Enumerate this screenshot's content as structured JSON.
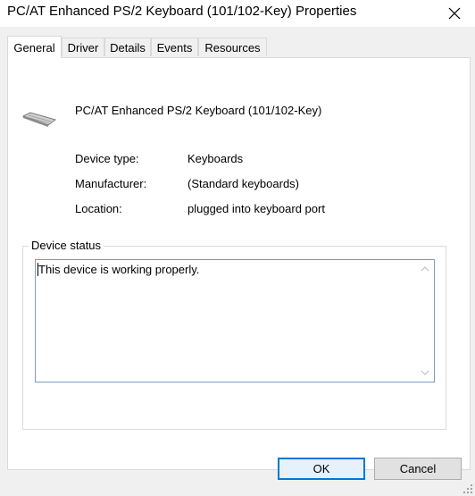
{
  "window": {
    "title": "PC/AT Enhanced PS/2 Keyboard (101/102-Key) Properties",
    "close_icon": "close-icon"
  },
  "tabs": [
    {
      "label": "General",
      "active": true
    },
    {
      "label": "Driver",
      "active": false
    },
    {
      "label": "Details",
      "active": false
    },
    {
      "label": "Events",
      "active": false
    },
    {
      "label": "Resources",
      "active": false
    }
  ],
  "general": {
    "device_icon": "keyboard-icon",
    "device_name": "PC/AT Enhanced PS/2 Keyboard (101/102-Key)",
    "properties": [
      {
        "label": "Device type:",
        "value": "Keyboards"
      },
      {
        "label": "Manufacturer:",
        "value": "(Standard keyboards)"
      },
      {
        "label": "Location:",
        "value": "plugged into keyboard port"
      }
    ],
    "status_group_label": "Device status",
    "status_text": "This device is working properly."
  },
  "buttons": {
    "ok": "OK",
    "cancel": "Cancel"
  },
  "colors": {
    "accent": "#0078d7",
    "dialog_background": "#f0f0f0"
  }
}
